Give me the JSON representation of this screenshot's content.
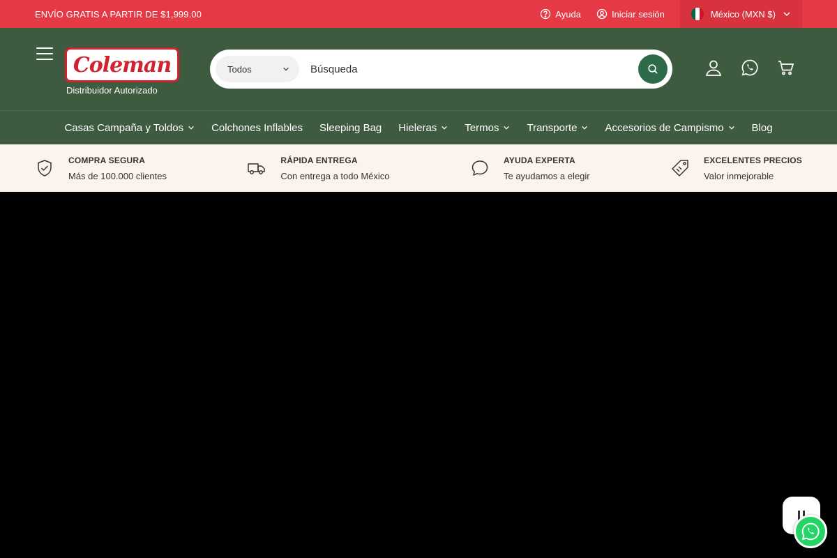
{
  "topbar": {
    "promo": "ENVÍO GRATIS A PARTIR DE $1,999.00",
    "help": "Ayuda",
    "login": "Iniciar sesión",
    "country": "México (MXN $)"
  },
  "header": {
    "logo_text": "Coleman",
    "logo_sub": "Distribuidor Autorizado",
    "search_category": "Todos",
    "search_placeholder": "Búsqueda"
  },
  "nav": {
    "items": [
      {
        "label": "Casas Campaña y Toldos",
        "dropdown": true
      },
      {
        "label": "Colchones Inflables",
        "dropdown": false
      },
      {
        "label": "Sleeping Bag",
        "dropdown": false
      },
      {
        "label": "Hieleras",
        "dropdown": true
      },
      {
        "label": "Termos",
        "dropdown": true
      },
      {
        "label": "Transporte",
        "dropdown": true
      },
      {
        "label": "Accesorios de Campismo",
        "dropdown": true
      },
      {
        "label": "Blog",
        "dropdown": false
      }
    ]
  },
  "trust": [
    {
      "title": "COMPRA SEGURA",
      "sub": "Más de 100.000 clientes",
      "icon": "shield-check-icon"
    },
    {
      "title": "RÁPIDA ENTREGA",
      "sub": "Con entrega a todo México",
      "icon": "truck-icon"
    },
    {
      "title": "AYUDA EXPERTA",
      "sub": "Te ayudamos a elegir",
      "icon": "chat-icon"
    },
    {
      "title": "EXCELENTES PRECIOS",
      "sub": "Valor inmejorable",
      "icon": "tag-icon"
    }
  ],
  "colors": {
    "topbar": "#e63946",
    "header": "#3e5a3f",
    "search_button": "#2e6b4a",
    "trust_bg": "#fbf3ec",
    "whatsapp": "#25d366"
  }
}
